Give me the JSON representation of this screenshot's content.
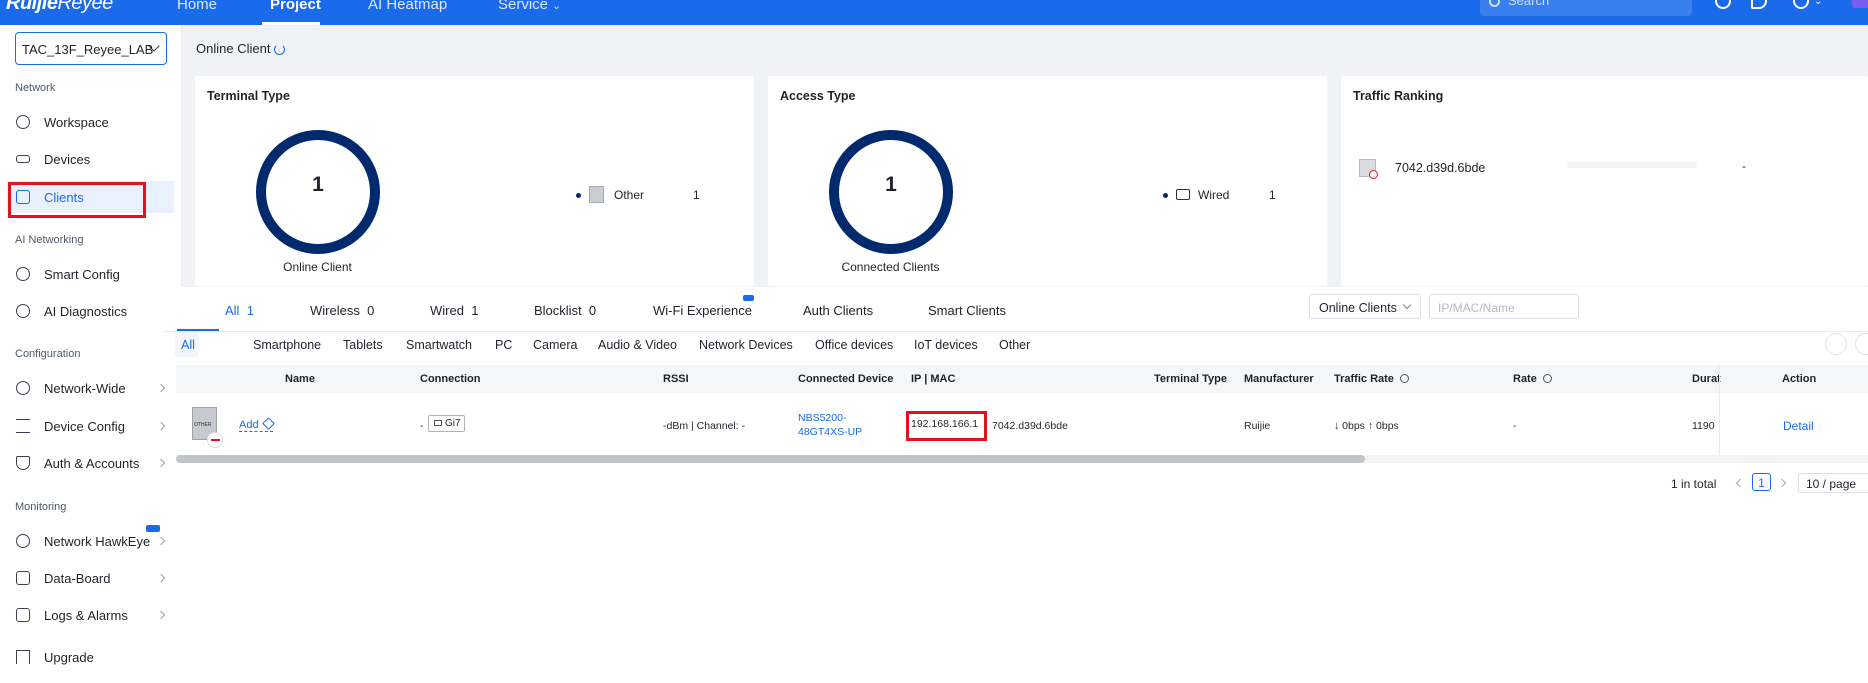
{
  "header": {
    "logo": {
      "brand": "Ruijie",
      "product": "Reyee"
    },
    "nav": [
      {
        "label": "Home"
      },
      {
        "label": "Project"
      },
      {
        "label": "AI Heatmap"
      },
      {
        "label": "Service"
      }
    ],
    "search_placeholder": "Search"
  },
  "sidebar": {
    "project": "TAC_13F_Reyee_LAB",
    "sections": {
      "network": "Network",
      "ai_networking": "AI Networking",
      "configuration": "Configuration",
      "monitoring": "Monitoring"
    },
    "items": {
      "workspace": "Workspace",
      "devices": "Devices",
      "clients": "Clients",
      "smart_config": "Smart Config",
      "ai_diagnostics": "AI Diagnostics",
      "network_wide": "Network-Wide",
      "device_config": "Device Config",
      "auth_accounts": "Auth & Accounts",
      "network_hawkeye": "Network HawkEye",
      "data_board": "Data-Board",
      "logs_alarms": "Logs & Alarms",
      "upgrade": "Upgrade"
    }
  },
  "page": {
    "title": "Online Client"
  },
  "cards": {
    "terminal_type": {
      "title": "Terminal Type",
      "total": "1",
      "caption": "Online Client",
      "legend": [
        {
          "name": "Other",
          "value": "1"
        }
      ]
    },
    "access_type": {
      "title": "Access Type",
      "total": "1",
      "caption": "Connected Clients",
      "legend": [
        {
          "name": "Wired",
          "value": "1"
        }
      ]
    },
    "traffic_ranking": {
      "title": "Traffic Ranking",
      "items": [
        {
          "name": "7042.d39d.6bde",
          "value": "-"
        }
      ]
    }
  },
  "tabs": [
    {
      "label": "All",
      "count": "1"
    },
    {
      "label": "Wireless",
      "count": "0"
    },
    {
      "label": "Wired",
      "count": "1"
    },
    {
      "label": "Blocklist",
      "count": "0"
    },
    {
      "label": "Wi-Fi Experience",
      "count": ""
    },
    {
      "label": "Auth Clients",
      "count": ""
    },
    {
      "label": "Smart Clients",
      "count": ""
    }
  ],
  "filters": {
    "status_select": "Online Clients",
    "search_placeholder": "IP/MAC/Name"
  },
  "sub_tabs": [
    "All",
    "Smartphone",
    "Tablets",
    "Smartwatch",
    "PC",
    "Camera",
    "Audio & Video",
    "Network Devices",
    "Office devices",
    "IoT devices",
    "Other"
  ],
  "table": {
    "columns": [
      "Name",
      "Connection",
      "RSSI",
      "Connected Device",
      "IP | MAC",
      "Terminal Type",
      "Manufacturer",
      "Traffic Rate",
      "Rate",
      "Durat",
      "Action"
    ],
    "rows": [
      {
        "thumb_text": "OTHER",
        "name": "Add",
        "connection_prefix": "-",
        "port": "Gi7",
        "rssi": "-dBm | Channel: -",
        "connected_device": "NBS5200-48GT4XS-UP",
        "ip": "192.168.166.1",
        "mac": "7042.d39d.6bde",
        "terminal_type": "",
        "manufacturer": "Ruijie",
        "traffic_rate": "↓ 0bps ↑ 0bps",
        "rate": "-",
        "duration": "1190",
        "action": "Detail"
      }
    ]
  },
  "pagination": {
    "total": "1 in total",
    "current": "1",
    "page_size": "10 / page"
  },
  "colors": {
    "primary": "#1a6aec",
    "ring": "#002a6e",
    "highlight": "#e0141e"
  }
}
